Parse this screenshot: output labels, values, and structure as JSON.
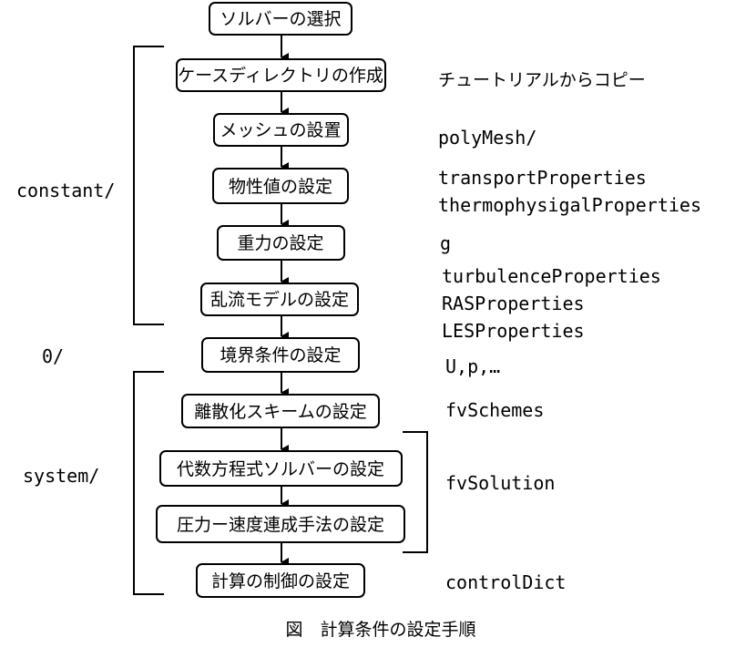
{
  "steps": [
    {
      "label": "ソルバーの選択"
    },
    {
      "label": "ケースディレクトリの作成"
    },
    {
      "label": "メッシュの設置"
    },
    {
      "label": "物性値の設定"
    },
    {
      "label": "重力の設定"
    },
    {
      "label": "乱流モデルの設定"
    },
    {
      "label": "境界条件の設定"
    },
    {
      "label": "離散化スキームの設定"
    },
    {
      "label": "代数方程式ソルバーの設定"
    },
    {
      "label": "圧力ー速度連成手法の設定"
    },
    {
      "label": "計算の制御の設定"
    }
  ],
  "groups": {
    "constant": "constant/",
    "zero": "0/",
    "system": "system/"
  },
  "files": {
    "tutorial_copy": "チュートリアルからコピー",
    "polymesh": "polyMesh/",
    "transport": "transportProperties",
    "thermo": "thermophysigalProperties",
    "g": "g",
    "turbulence": "turbulenceProperties",
    "ras": "RASProperties",
    "les": "LESProperties",
    "fields": "U,p,…",
    "fvschemes": "fvSchemes",
    "fvsolution": "fvSolution",
    "controldict": "controlDict"
  },
  "caption": "図　計算条件の設定手順"
}
